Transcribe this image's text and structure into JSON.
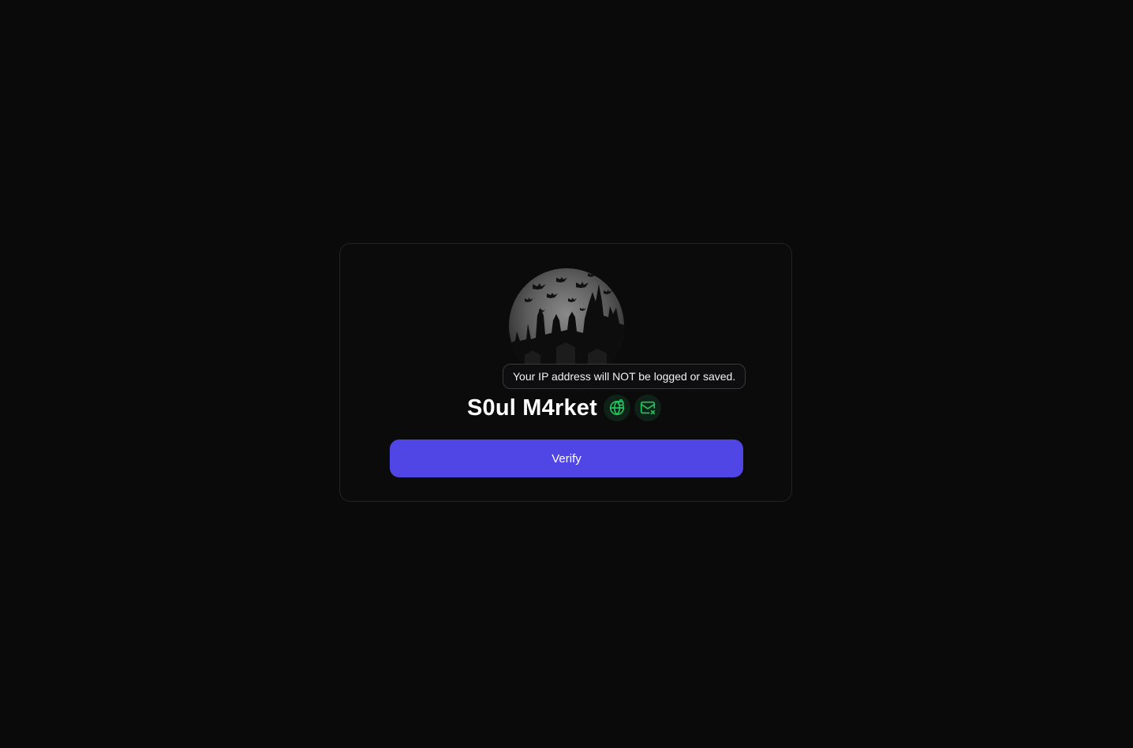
{
  "profile": {
    "name": "S0ul M4rket",
    "avatar_icon": "gothic-castle-bats-avatar"
  },
  "tooltip": {
    "text": "Your IP address will NOT be logged or saved."
  },
  "badges": [
    {
      "icon": "globe-lock-icon",
      "color": "#22c55e"
    },
    {
      "icon": "mail-x-icon",
      "color": "#22c55e"
    }
  ],
  "actions": {
    "verify_label": "Verify"
  },
  "colors": {
    "background": "#0b0a0b",
    "accent": "#4f46e5",
    "badge_green": "#22c55e"
  }
}
